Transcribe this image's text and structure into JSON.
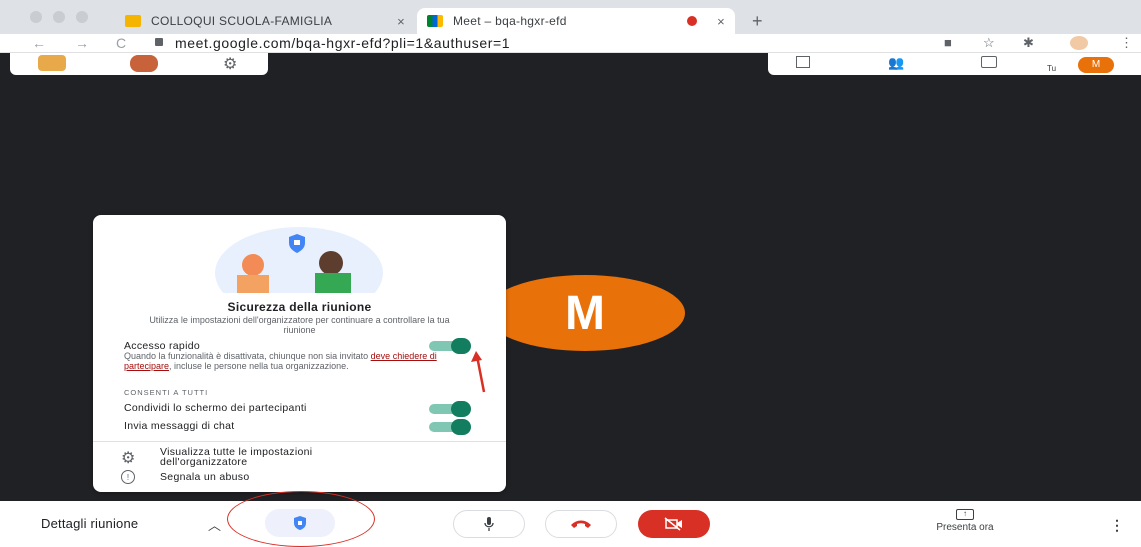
{
  "browser": {
    "tabs": [
      {
        "title": "COLLOQUI SCUOLA-FAMIGLIA",
        "close": "×",
        "active": false
      },
      {
        "title": "Meet – bqa-hgxr-efd",
        "close": "×",
        "active": true
      }
    ],
    "new_tab": "+",
    "url": "meet.google.com/bqa-hgxr-efd?pli=1&authuser=1",
    "nav": {
      "back": "←",
      "forward": "→",
      "reload": "C"
    }
  },
  "top_right": {
    "you_label": "Tu",
    "avatar_letter": "M"
  },
  "tile": {
    "letter": "M",
    "color": "#e8710a"
  },
  "security_panel": {
    "title": "Sicurezza della riunione",
    "subtitle": "Utilizza le impostazioni dell'organizzatore per continuare a controllare la tua riunione",
    "quick_access": {
      "label": "Accesso rapido",
      "desc_part1": "Quando la funzionalità è disattivata, chiunque non sia invitato ",
      "desc_link": "deve chiedere di partecipare",
      "desc_part2": ", incluse le persone nella tua organizzazione.",
      "enabled": true
    },
    "allow_all_header": "CONSENTI A TUTTI",
    "options": [
      {
        "label": "Condividi lo schermo dei partecipanti",
        "enabled": true
      },
      {
        "label": "Invia messaggi di chat",
        "enabled": true
      }
    ],
    "footer": {
      "view_settings_1": "Visualizza tutte le impostazioni",
      "view_settings_2": "dell'organizzatore",
      "report": "Segnala un abuso",
      "report_icon_glyph": "!"
    }
  },
  "bottom_bar": {
    "details_label": "Dettagli riunione",
    "chevron": "︿",
    "present_label": "Presenta ora",
    "more": "⋮"
  },
  "colors": {
    "accent_green": "#137e5f",
    "end_call_red": "#d93025",
    "meet_bg": "#202124"
  }
}
